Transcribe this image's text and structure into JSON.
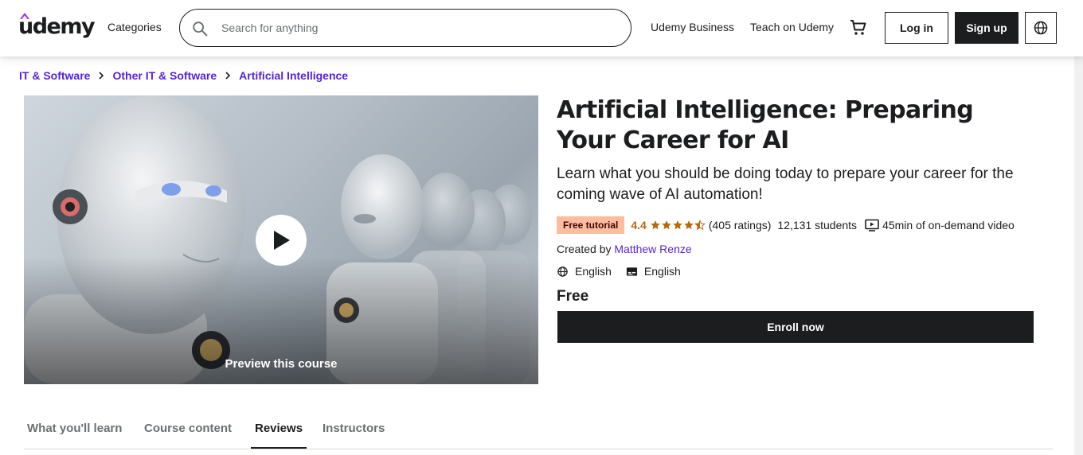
{
  "header": {
    "logo_text": "udemy",
    "categories_label": "Categories",
    "search_placeholder": "Search for anything",
    "business_label": "Udemy Business",
    "teach_label": "Teach on Udemy",
    "login_label": "Log in",
    "signup_label": "Sign up"
  },
  "breadcrumb": [
    "IT & Software",
    "Other IT & Software",
    "Artificial Intelligence"
  ],
  "preview": {
    "label": "Preview this course"
  },
  "course": {
    "title": "Artificial Intelligence: Preparing Your Career for AI",
    "subtitle": "Learn what you should be doing today to prepare your career for the coming wave of AI automation!",
    "badge": "Free tutorial",
    "rating": "4.4",
    "ratings_count": "(405 ratings)",
    "students": "12,131 students",
    "video_length": "45min of on-demand video",
    "created_by_label": "Created by",
    "instructor": "Matthew Renze",
    "language": "English",
    "captions": "English",
    "price": "Free",
    "enroll_label": "Enroll now"
  },
  "tabs": [
    "What you'll learn",
    "Course content",
    "Reviews",
    "Instructors"
  ],
  "colors": {
    "accent": "#5624d0",
    "dark": "#1c1d1f",
    "badge_bg": "#fcbca0",
    "rating": "#b4690e"
  }
}
